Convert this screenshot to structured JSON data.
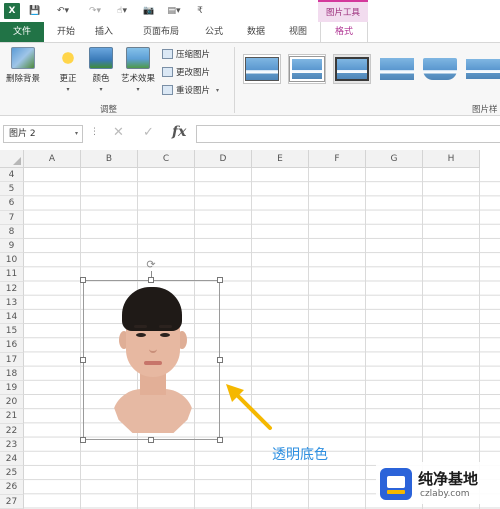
{
  "quick_access": {
    "app_logo": "X",
    "save_icon": "💾",
    "undo_icon": "↶▾",
    "redo_icon": "↷▾",
    "touch_icon": "☝▾",
    "camera_icon": "📷",
    "form_icon": "▤▾",
    "more_icon": "₹"
  },
  "contextual_header": "图片工具",
  "tabs": {
    "file": "文件",
    "home": "开始",
    "insert": "插入",
    "page_layout": "页面布局",
    "formulas": "公式",
    "data": "数据",
    "view": "视图",
    "format": "格式"
  },
  "ribbon": {
    "remove_background": "删除背景",
    "corrections": "更正",
    "color": "颜色",
    "artistic_effects": "艺术效果",
    "compress_pictures": "压缩图片",
    "change_picture": "更改图片",
    "reset_picture": "重设图片",
    "adjust_group": "调整",
    "styles_group": "图片样"
  },
  "formula_bar": {
    "name_box": "图片 2",
    "dots": "⋮",
    "cancel": "✕",
    "enter": "✓",
    "fx": "fx",
    "formula": ""
  },
  "grid": {
    "columns": [
      "A",
      "B",
      "C",
      "D",
      "E",
      "F",
      "G",
      "H"
    ],
    "rows": [
      "4",
      "5",
      "6",
      "7",
      "8",
      "9",
      "10",
      "11",
      "12",
      "13",
      "14",
      "15",
      "16",
      "17",
      "18",
      "19",
      "20",
      "21",
      "22",
      "23",
      "24",
      "25",
      "26",
      "27"
    ]
  },
  "annotation": "透明底色",
  "watermark": {
    "title": "纯净基地",
    "url": "czlaby.com"
  },
  "colors": {
    "excel_green": "#217346",
    "format_tab_accent": "#b03493",
    "annotation_blue": "#2e8fe0",
    "arrow_yellow": "#f5b800"
  }
}
